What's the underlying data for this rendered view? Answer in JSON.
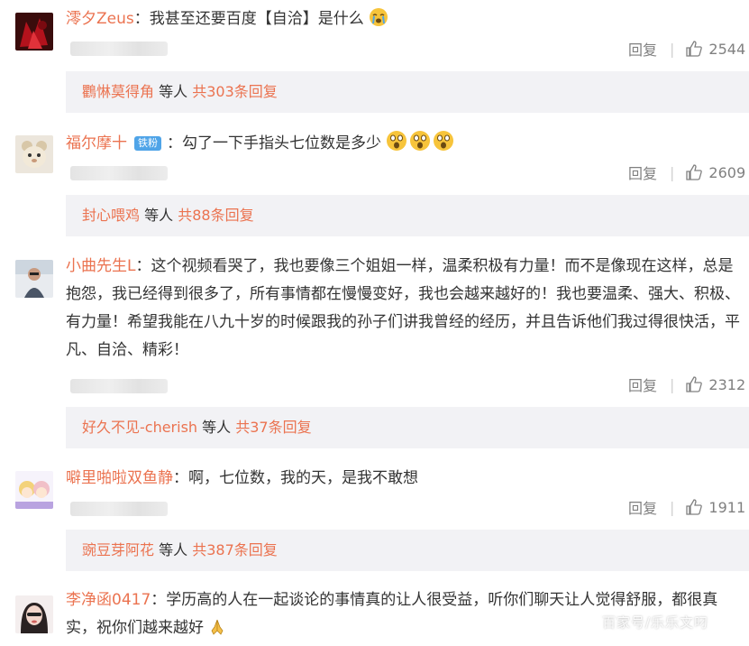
{
  "comments": [
    {
      "username": "澪夕Zeus",
      "content": "：我甚至还要百度【自洽】是什么",
      "reply_label": "回复",
      "likes": "2544",
      "replies": {
        "first_user": "鸜惏莫得角",
        "and_label": " 等人 ",
        "count_label": "共303条回复"
      }
    },
    {
      "username": "福尔摩十",
      "badge": "铁粉",
      "content": "：勾了一下手指头七位数是多少",
      "reply_label": "回复",
      "likes": "2609",
      "replies": {
        "first_user": "封心喂鸡",
        "and_label": " 等人 ",
        "count_label": "共88条回复"
      }
    },
    {
      "username": "小曲先生L",
      "content": "：这个视频看哭了，我也要像三个姐姐一样，温柔积极有力量！而不是像现在这样，总是抱怨，我已经得到很多了，所有事情都在慢慢变好，我也会越来越好的！我也要温柔、强大、积极、有力量！希望我能在八九十岁的时候跟我的孙子们讲我曾经的经历，并且告诉他们我过得很快活，平凡、自洽、精彩！",
      "reply_label": "回复",
      "likes": "2312",
      "replies": {
        "first_user": "好久不见-cherish",
        "and_label": " 等人 ",
        "count_label": "共37条回复"
      }
    },
    {
      "username": "噼里啪啦双鱼静",
      "content": "：啊，七位数，我的天，是我不敢想",
      "reply_label": "回复",
      "likes": "1911",
      "replies": {
        "first_user": "豌豆芽阿花",
        "and_label": " 等人 ",
        "count_label": "共387条回复"
      }
    },
    {
      "username": "李净函0417",
      "content": "：学历高的人在一起谈论的事情真的让人很受益，听你们聊天让人觉得舒服，都很真实，祝你们越来越好"
    }
  ],
  "watermark": "百家号/乐乐文叼",
  "colors": {
    "username": "#eb7350",
    "badge": "#4fa4e8",
    "reply_bg": "#f2f2f5",
    "meta": "#808080"
  },
  "icons": {
    "like": "thumbs-up-icon",
    "emoji_cry": "crying-face-emoji",
    "emoji_shock": "shocked-face-emoji",
    "emoji_pray": "praying-hands-emoji"
  }
}
